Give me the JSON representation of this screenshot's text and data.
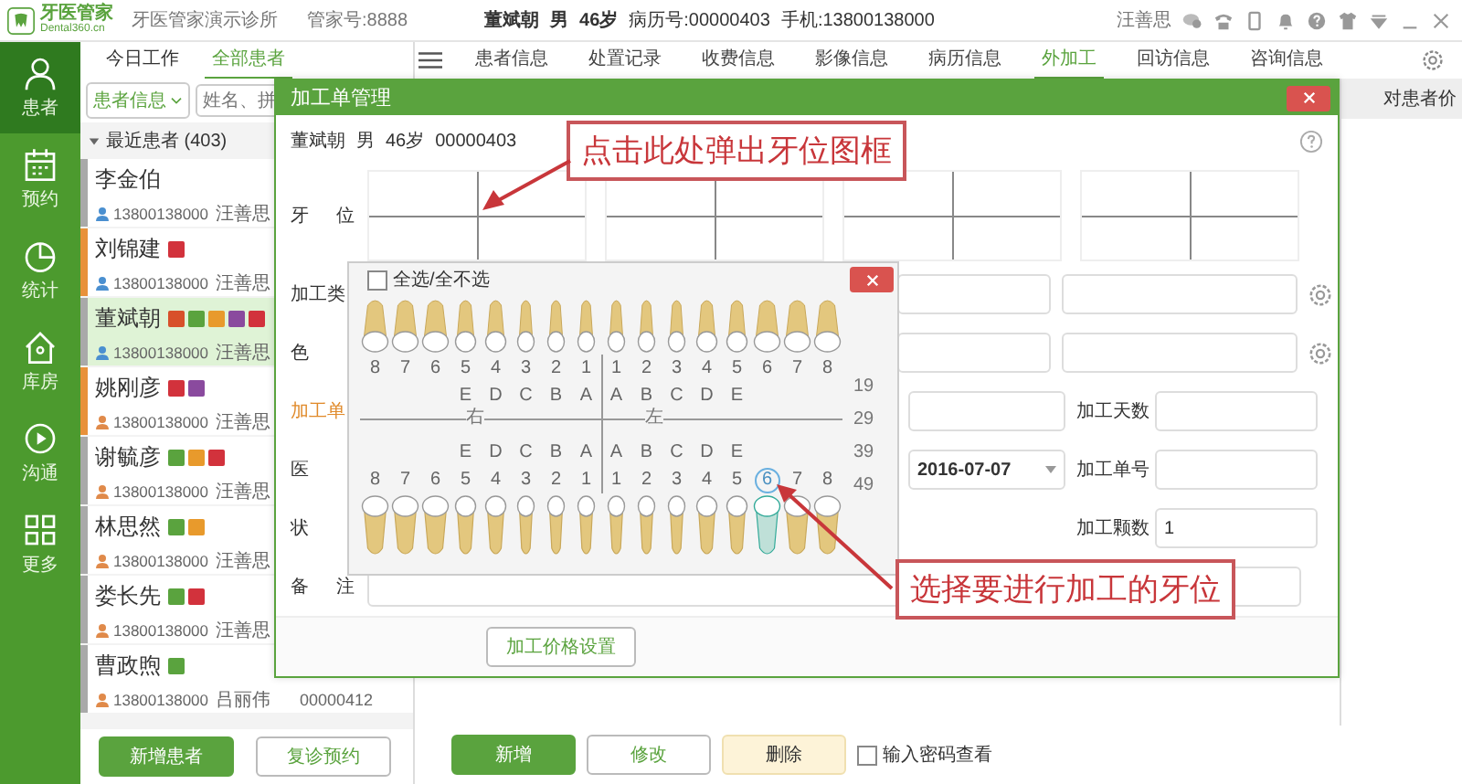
{
  "app": {
    "logo_name": "牙医管家",
    "logo_domain": "Dental360.cn",
    "clinic": "牙医管家演示诊所",
    "account": "管家号:8888"
  },
  "current_patient": {
    "name": "董斌朝",
    "sex": "男",
    "age": "46岁",
    "record_no": "病历号:00000403",
    "phone": "手机:13800138000"
  },
  "user": "汪善思",
  "nav": [
    {
      "label": "患者",
      "kind": "person",
      "selected": true
    },
    {
      "label": "预约",
      "kind": "calendar",
      "selected": false
    },
    {
      "label": "统计",
      "kind": "chart",
      "selected": false
    },
    {
      "label": "库房",
      "kind": "house",
      "selected": false
    },
    {
      "label": "沟通",
      "kind": "play",
      "selected": false
    },
    {
      "label": "更多",
      "kind": "grid",
      "selected": false
    }
  ],
  "left_tabs": [
    {
      "label": "今日工作",
      "selected": false
    },
    {
      "label": "全部患者",
      "selected": true
    }
  ],
  "search": {
    "filter": "患者信息",
    "placeholder": "姓名、拼"
  },
  "group": {
    "label": "最近患者 (403)",
    "expanded": true
  },
  "patients": [
    {
      "name": "李金伯",
      "person_icon": {
        "color": "#4a8fd0"
      },
      "color": "#a9a9a9",
      "phone": "13800138000",
      "doctor": "汪善思",
      "selected": false
    },
    {
      "name": "刘锦建",
      "person_icon": {
        "color": "#4a8fd0"
      },
      "color": "#e8913a",
      "phone": "13800138000",
      "doctor": "汪善思",
      "selected": false,
      "tags": [
        {
          "color": "#d2323c"
        }
      ]
    },
    {
      "name": "董斌朝",
      "person_icon": {
        "color": "#4a8fd0"
      },
      "color": "#a9a9a9",
      "phone": "13800138000",
      "doctor": "汪善思",
      "selected": true,
      "tags": [
        {
          "color": "#d8502a"
        },
        {
          "color": "#5aa33e"
        },
        {
          "color": "#e89a2c"
        },
        {
          "color": "#8a4a9e"
        },
        {
          "color": "#d2323c"
        }
      ]
    },
    {
      "name": "姚刚彦",
      "person_icon": {
        "color": "#e08a4a"
      },
      "color": "#e8913a",
      "phone": "13800138000",
      "doctor": "汪善思",
      "selected": false,
      "tags": [
        {
          "color": "#d2323c"
        },
        {
          "color": "#8a4a9e"
        }
      ]
    },
    {
      "name": "谢毓彦",
      "person_icon": {
        "color": "#e08a4a"
      },
      "color": "#a9a9a9",
      "phone": "13800138000",
      "doctor": "汪善思",
      "selected": false,
      "tags": [
        {
          "color": "#5aa33e"
        },
        {
          "color": "#e89a2c"
        },
        {
          "color": "#d2323c"
        }
      ]
    },
    {
      "name": "林思然",
      "person_icon": {
        "color": "#e08a4a"
      },
      "color": "#a9a9a9",
      "phone": "13800138000",
      "doctor": "汪善思",
      "selected": false,
      "tags": [
        {
          "color": "#5aa33e"
        },
        {
          "color": "#e89a2c"
        }
      ]
    },
    {
      "name": "娄长先",
      "person_icon": {
        "color": "#e08a4a"
      },
      "color": "#a9a9a9",
      "phone": "13800138000",
      "doctor": "汪善思",
      "selected": false,
      "tags": [
        {
          "color": "#5aa33e"
        },
        {
          "color": "#d2323c"
        }
      ]
    },
    {
      "name": "曹政煦",
      "person_icon": {
        "color": "#e08a4a"
      },
      "color": "#a9a9a9",
      "phone": "13800138000",
      "doctor": "吕丽伟",
      "record_no": "00000412",
      "selected": false,
      "tags": [
        {
          "color": "#5aa33e"
        }
      ]
    }
  ],
  "list_buttons": [
    {
      "label": "新增患者",
      "kind": "primary"
    },
    {
      "label": "复诊预约",
      "kind": "secondary"
    }
  ],
  "tabs": [
    {
      "label": "患者信息",
      "selected": false
    },
    {
      "label": "处置记录",
      "selected": false
    },
    {
      "label": "收费信息",
      "selected": false
    },
    {
      "label": "影像信息",
      "selected": false
    },
    {
      "label": "病历信息",
      "selected": false
    },
    {
      "label": "外加工",
      "selected": true
    },
    {
      "label": "回访信息",
      "selected": false
    },
    {
      "label": "咨询信息",
      "selected": false
    }
  ],
  "panel": {
    "column": "对患者价"
  },
  "actions": [
    {
      "label": "新增",
      "kind": "primary"
    },
    {
      "label": "修改",
      "kind": "secondary"
    },
    {
      "label": "删除",
      "kind": "warning"
    }
  ],
  "password_view": {
    "label": "输入密码查看",
    "checked": false
  },
  "dialog": {
    "title": "加工单管理",
    "patient": {
      "name": "董斌朝",
      "sex": "男",
      "age": "46岁",
      "record_no": "00000403"
    },
    "tooth_label": "牙 位",
    "rows": [
      {
        "label": "加工类",
        "highlight": false,
        "cells": [
          {
            "kind": "input"
          },
          {
            "kind": "input"
          },
          {
            "kind": "gear"
          }
        ]
      },
      {
        "label": "色",
        "highlight": false,
        "cells": [
          {
            "kind": "input"
          },
          {
            "kind": "input"
          },
          {
            "kind": "gear"
          }
        ]
      },
      {
        "label": "加工单",
        "highlight": true,
        "cells": [
          {
            "kind": "input"
          },
          {
            "kind": "labeled",
            "label": "加工天数"
          }
        ]
      },
      {
        "label": "医",
        "highlight": false,
        "cells": [
          {
            "kind": "select",
            "value": "2016-07-07"
          },
          {
            "kind": "labeled",
            "label": "加工单号"
          }
        ]
      },
      {
        "label": "状",
        "highlight": false,
        "cells": [
          {
            "kind": "none"
          },
          {
            "kind": "labeled",
            "label": "加工颗数",
            "value": "1"
          }
        ]
      }
    ],
    "remark_label": "备 注",
    "price_button": "加工价格设置",
    "picker": {
      "select_all": {
        "label": "全选/全不选",
        "checked": false
      },
      "right_label": "右",
      "left_label": "左",
      "side_numbers": [
        "19",
        "29",
        "39",
        "49"
      ],
      "upper_numbers": [
        {
          "label": "8",
          "selected": false
        },
        {
          "label": "7",
          "selected": false
        },
        {
          "label": "6",
          "selected": false
        },
        {
          "label": "5",
          "selected": false
        },
        {
          "label": "4",
          "selected": false
        },
        {
          "label": "3",
          "selected": false
        },
        {
          "label": "2",
          "selected": false
        },
        {
          "label": "1",
          "selected": false
        },
        {
          "label": "1",
          "selected": false
        },
        {
          "label": "2",
          "selected": false
        },
        {
          "label": "3",
          "selected": false
        },
        {
          "label": "4",
          "selected": false
        },
        {
          "label": "5",
          "selected": false
        },
        {
          "label": "6",
          "selected": false
        },
        {
          "label": "7",
          "selected": false
        },
        {
          "label": "8",
          "selected": false
        }
      ],
      "upper_letters": [
        "E",
        "D",
        "C",
        "B",
        "A",
        "A",
        "B",
        "C",
        "D",
        "E"
      ],
      "lower_letters": [
        "E",
        "D",
        "C",
        "B",
        "A",
        "A",
        "B",
        "C",
        "D",
        "E"
      ],
      "lower_numbers": [
        {
          "label": "8",
          "selected": false
        },
        {
          "label": "7",
          "selected": false
        },
        {
          "label": "6",
          "selected": false
        },
        {
          "label": "5",
          "selected": false
        },
        {
          "label": "4",
          "selected": false
        },
        {
          "label": "3",
          "selected": false
        },
        {
          "label": "2",
          "selected": false
        },
        {
          "label": "1",
          "selected": false
        },
        {
          "label": "1",
          "selected": false
        },
        {
          "label": "2",
          "selected": false
        },
        {
          "label": "3",
          "selected": false
        },
        {
          "label": "4",
          "selected": false
        },
        {
          "label": "5",
          "selected": false
        },
        {
          "label": "6",
          "selected": true
        },
        {
          "label": "7",
          "selected": false
        },
        {
          "label": "8",
          "selected": false
        }
      ]
    }
  },
  "callouts": [
    {
      "text": "点击此处弹出牙位图框"
    },
    {
      "text": "选择要进行加工的牙位"
    }
  ]
}
